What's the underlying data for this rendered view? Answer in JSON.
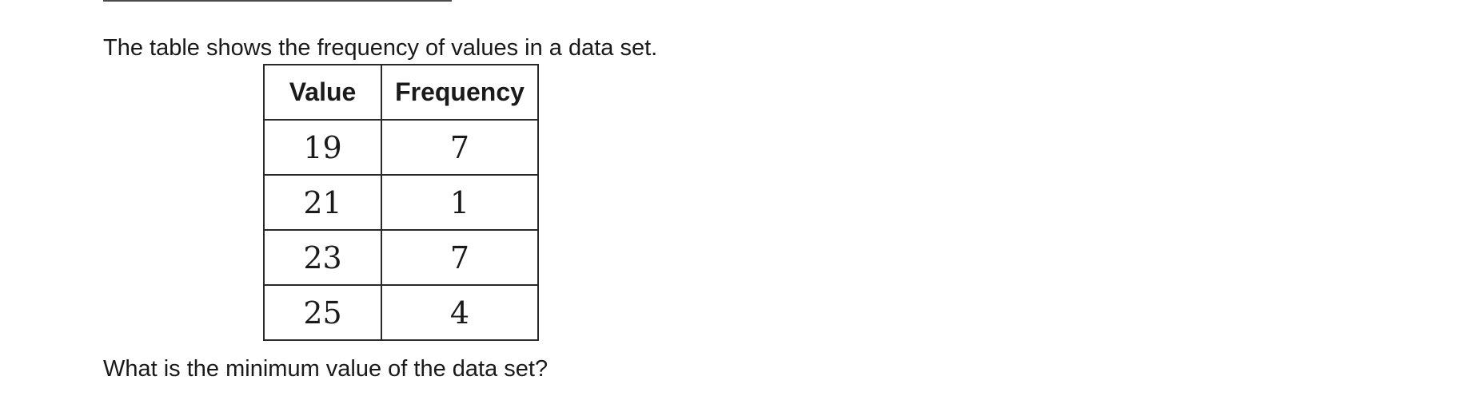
{
  "intro": "The table shows the frequency of values in a data set.",
  "table": {
    "headers": [
      "Value",
      "Frequency"
    ],
    "rows": [
      [
        "19",
        "7"
      ],
      [
        "21",
        "1"
      ],
      [
        "23",
        "7"
      ],
      [
        "25",
        "4"
      ]
    ]
  },
  "question": "What is the minimum value of the data set?"
}
